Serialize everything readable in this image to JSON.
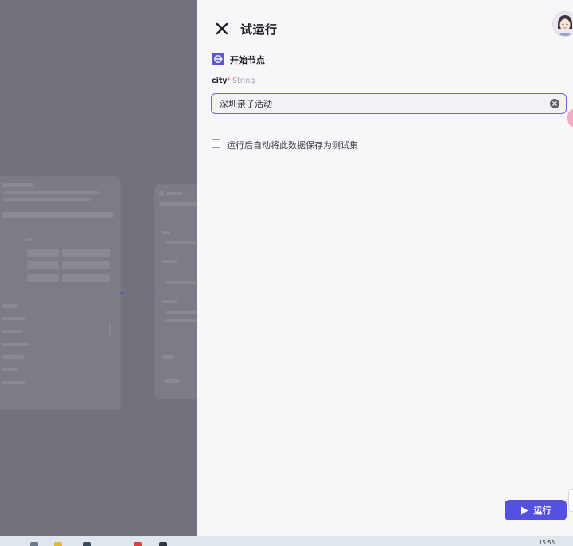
{
  "panel": {
    "title": "试运行",
    "node_title": "开始节点"
  },
  "field": {
    "name": "city",
    "required_mark": "*",
    "type": "String",
    "value": "深圳亲子活动"
  },
  "save_option": {
    "label": "运行后自动将此数据保存为测试集",
    "checked": false
  },
  "run_button": {
    "label": "运行"
  },
  "taskbar": {
    "clock": "15:55"
  },
  "colors": {
    "accent": "#5551e0",
    "input_border": "#6b66e0",
    "panel_bg": "#f7f7fa",
    "overlay": "#72727c"
  }
}
